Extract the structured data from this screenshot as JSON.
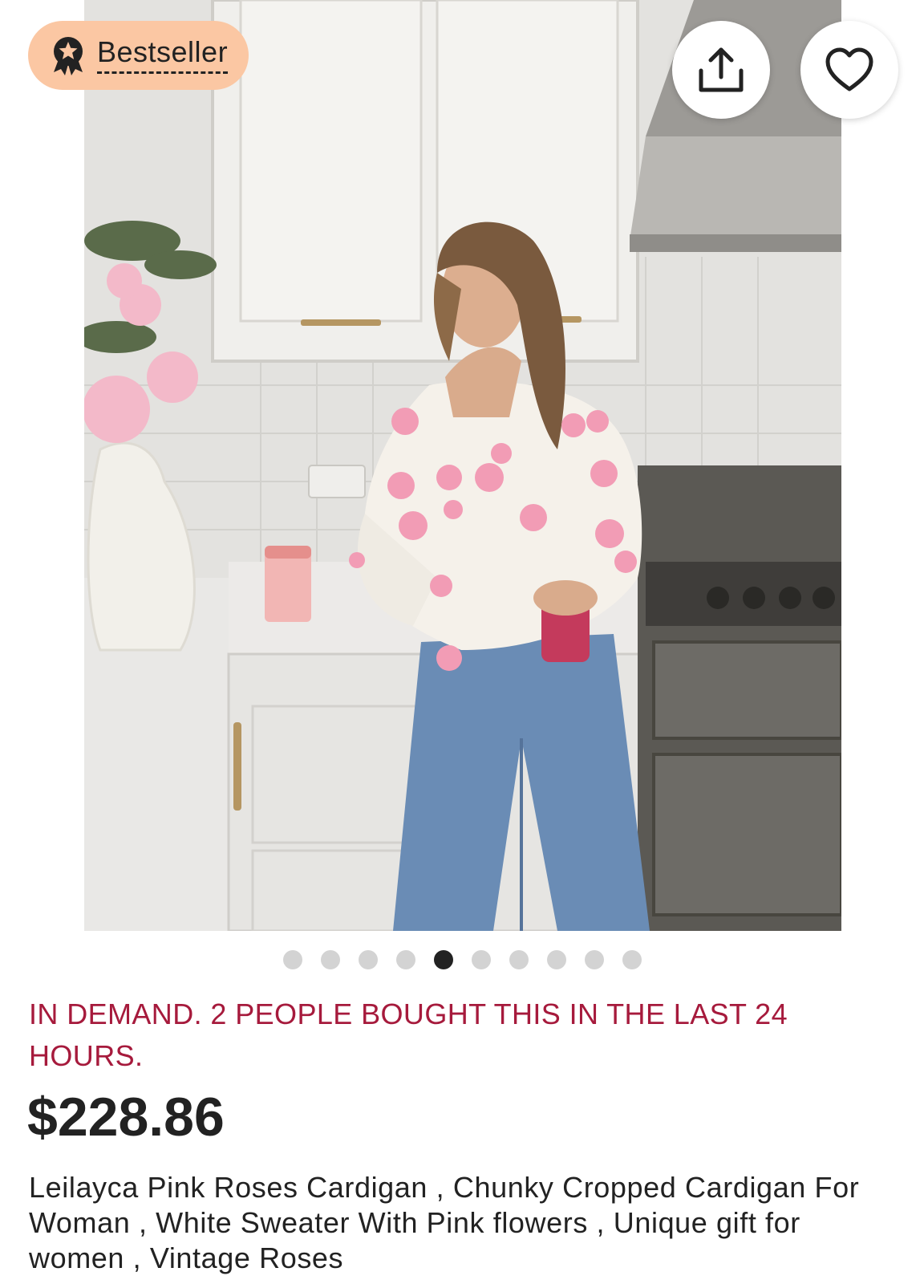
{
  "badge": {
    "label": "Bestseller",
    "icon": "award-ribbon-icon",
    "background": "#fbc7a3"
  },
  "actions": {
    "share_icon": "share-upload-icon",
    "favorite_icon": "heart-outline-icon"
  },
  "carousel": {
    "total_images": 10,
    "active_index": 4
  },
  "demand_notice": "IN DEMAND. 2 PEOPLE BOUGHT THIS IN THE LAST 24 HOURS.",
  "price": "$228.86",
  "product_title": "Leilayca Pink Roses Cardigan , Chunky Cropped Cardigan For Woman , White Sweater With Pink flowers , Unique gift for women , Vintage Roses",
  "colors": {
    "demand_text": "#a61a3c",
    "dot_active": "#222222",
    "dot_inactive": "#d3d3d3"
  }
}
